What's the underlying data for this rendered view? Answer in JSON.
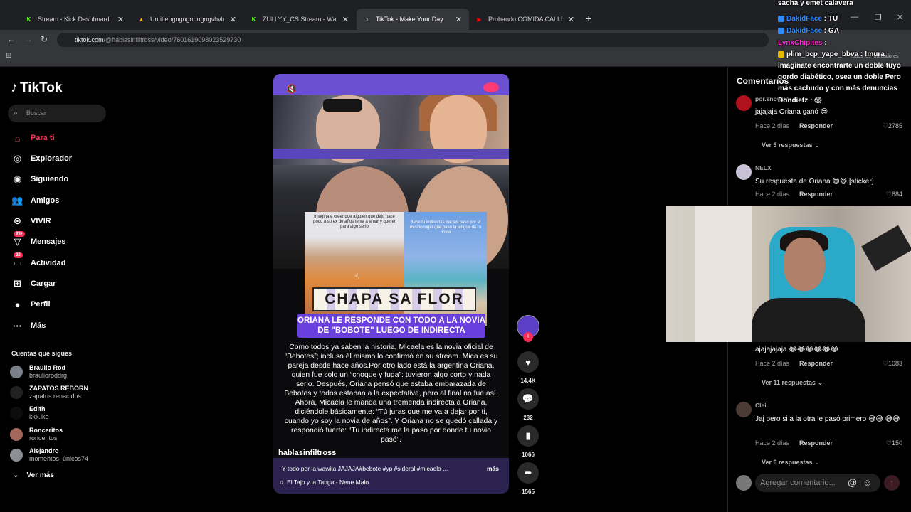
{
  "browser": {
    "tabs": [
      {
        "title": "Stream - Kick Dashboard",
        "fav": "K",
        "color": "#53fc18"
      },
      {
        "title": "Untitlehgngngnbngngvhvb d.jp",
        "fav": "▲",
        "color": "#fbbc04"
      },
      {
        "title": "ZULLYY_CS Stream - Watch Live",
        "fav": "K",
        "color": "#53fc18"
      },
      {
        "title": "TikTok - Make Your Day",
        "fav": "♪",
        "color": "#ffffff"
      },
      {
        "title": "Probando COMIDA CALLEJERA",
        "fav": "▶",
        "color": "#ff0000"
      }
    ],
    "url_host": "tiktok.com",
    "url_path": "/@hablasinfiltross/video/7601619098023529730",
    "bookmarks_hint": "Todos los marcadores"
  },
  "sidebar": {
    "logo": "TikTok",
    "search_placeholder": "Buscar",
    "nav": [
      {
        "label": "Para ti",
        "icon": "home-icon",
        "active": true
      },
      {
        "label": "Explorador",
        "icon": "compass-icon"
      },
      {
        "label": "Siguiendo",
        "icon": "following-icon"
      },
      {
        "label": "Amigos",
        "icon": "friends-icon"
      },
      {
        "label": "VIVIR",
        "icon": "live-icon"
      },
      {
        "label": "Mensajes",
        "icon": "messages-icon",
        "badge": "99+"
      },
      {
        "label": "Actividad",
        "icon": "activity-icon",
        "badge": "23"
      },
      {
        "label": "Cargar",
        "icon": "upload-icon"
      },
      {
        "label": "Perfil",
        "icon": "profile-icon"
      },
      {
        "label": "Más",
        "icon": "more-icon"
      }
    ],
    "following_title": "Cuentas que sigues",
    "following": [
      {
        "name": "Braulio Rod",
        "handle": "braulioroddrg"
      },
      {
        "name": "ZAPATOS REBORN",
        "handle": "zapatos renacidos"
      },
      {
        "name": "Edith",
        "handle": "kkk.lke"
      },
      {
        "name": "Ronceritos",
        "handle": "ronceritos"
      },
      {
        "name": "Alejandro",
        "handle": "momentos_únicos74"
      }
    ],
    "see_more": "Ver más"
  },
  "video": {
    "collage_left_text": "Imaginate creer que alguien que dejo hace poco a su ex de años te va a amar y querer para algo serio",
    "collage_right_text": "Bebe tu indirectas me las paso por el mismo lugar que paso la lengua de tu novia",
    "sticker_text": "CHAPA SA FLOR",
    "banner": "ORIANA LE RESPONDE CON TODO A LA NOVIA DE \"BOBOTE\" LUEGO DE INDIRECTA",
    "caption": "Como todos ya saben la historia, Micaela es la novia oficial de “Bebotes”; incluso él mismo lo confirmó en su stream. Mica es su pareja desde hace años.Por otro lado está la argentina Oriana, quien fue solo un “choque y fuga”: tuvieron algo corto y nada serio. Después, Oriana pensó que estaba embarazada de Bebotes y todos estaban a la expectativa, pero al final no fue así. Ahora, Micaela le manda una tremenda indirecta a Oriana, diciéndole básicamente: “Tú juras que me va a dejar por ti, cuando yo soy la novia de años”. Y Oriana no se quedó callada y respondió fuerte: “Tu indirecta me la paso por donde tu novio pasó”.",
    "author": "hablasinfiltross",
    "description": "Y todo por la wawita JAJAJA#bebote #yp #sideral #micaela ...",
    "more": "más",
    "music": "El Tajo y la Tanga - Nene Malo"
  },
  "actions": {
    "likes": "14.4K",
    "comments": "232",
    "saves": "1066",
    "shares": "1565"
  },
  "comments": {
    "title": "Comentarios",
    "items": [
      {
        "user": "por.snow07",
        "text": "jajajaja Oriana ganó 😎",
        "time": "Hace 2 días",
        "reply": "Responder",
        "likes": "2785",
        "replies": "Ver 3 respuestas"
      },
      {
        "user": "NELX",
        "text": "Su respuesta de Oriana 😅😅 [sticker]",
        "time": "Hace 2 días",
        "reply": "Responder",
        "likes": "684"
      },
      {
        "user": "",
        "text": "ajajajajaja 😂😂😂😂😂😂",
        "time": "Hace 2 días",
        "reply": "Responder",
        "likes": "1083",
        "replies": "Ver 11 respuestas"
      },
      {
        "user": "Clei",
        "text": "Jaj pero si a la otra le pasó primero 😅😅 😅😅",
        "time": "Hace 2 días",
        "reply": "Responder",
        "likes": "150",
        "replies": "Ver 6 respuestas"
      }
    ],
    "input_placeholder": "Agregar comentario..."
  },
  "chat": [
    {
      "user": "",
      "text": "sacha y emet calavera"
    },
    {
      "user": "DakidFace",
      "text": "TU"
    },
    {
      "user": "DakidFace",
      "text": "GA"
    },
    {
      "user": "LynxChipites",
      "text": ""
    },
    {
      "user": "plim_bcp_yape_bbva",
      "text": "!mura imaginate encontrarte un doble tuyo gordo diabético, osea un doble Pero más cachudo y con más denuncias"
    },
    {
      "user": "Dondietz",
      "text": "😱"
    }
  ]
}
